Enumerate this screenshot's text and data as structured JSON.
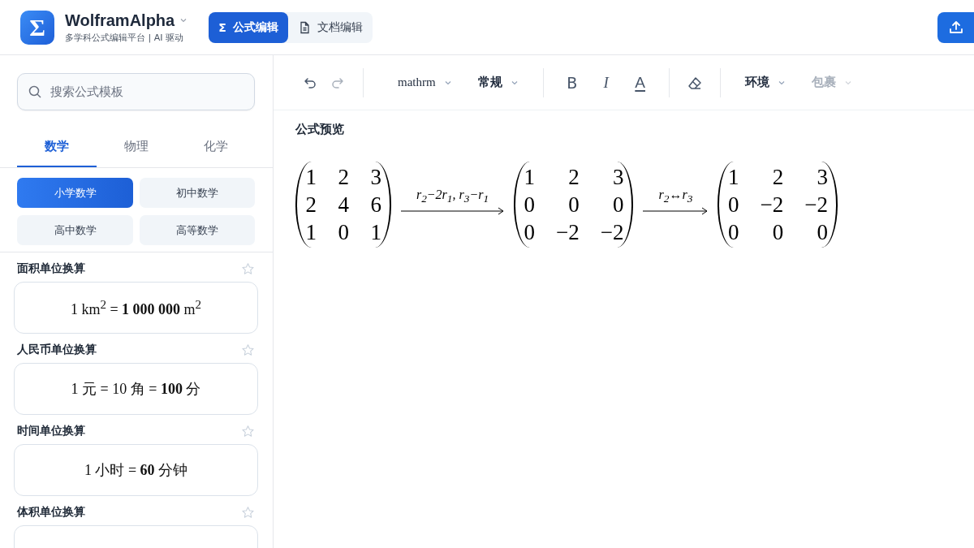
{
  "header": {
    "logo": "Σ",
    "title": "WolframAlpha",
    "subtitle": "多学科公式编辑平台 | AI 驱动",
    "modes": [
      {
        "label": "公式编辑",
        "glyph": "Σ",
        "selected": true
      },
      {
        "label": "文档编辑",
        "selected": false
      }
    ]
  },
  "sidebar": {
    "search": {
      "placeholder": "搜索公式模板"
    },
    "subjects": [
      {
        "label": "数学",
        "selected": true
      },
      {
        "label": "物理",
        "selected": false
      },
      {
        "label": "化学",
        "selected": false
      }
    ],
    "levels": [
      {
        "label": "小学数学",
        "selected": true
      },
      {
        "label": "初中数学",
        "selected": false
      },
      {
        "label": "高中数学",
        "selected": false
      },
      {
        "label": "高等数学",
        "selected": false
      }
    ],
    "templates": [
      {
        "title": "面积单位换算",
        "formula": "1 km$^{2}$ = **1 000 000** m$^{2}$"
      },
      {
        "title": "人民币单位换算",
        "formula": "1 元 = 10 角 = **100** 分"
      },
      {
        "title": "时间单位换算",
        "formula": "1 小时 = **60** 分钟"
      },
      {
        "title": "体积单位换算"
      }
    ]
  },
  "toolbar": [
    {
      "kind": "undo",
      "disabled": false
    },
    {
      "kind": "redo",
      "disabled": true
    },
    {
      "kind": "separator"
    },
    {
      "kind": "dropdown",
      "label": "mathrm",
      "serif": true,
      "disabled": false
    },
    {
      "kind": "dropdown",
      "label": "常规",
      "disabled": false
    },
    {
      "kind": "separator"
    },
    {
      "kind": "bold",
      "label": "B",
      "disabled": false
    },
    {
      "kind": "italic",
      "label": "I",
      "disabled": false
    },
    {
      "kind": "color",
      "label": "A",
      "disabled": false
    },
    {
      "kind": "separator"
    },
    {
      "kind": "eraser",
      "disabled": false
    },
    {
      "kind": "separator"
    },
    {
      "kind": "dropdown",
      "label": "环境",
      "disabled": false
    },
    {
      "kind": "dropdown",
      "label": "包裹",
      "disabled": true
    }
  ],
  "preview": {
    "title": "公式预览",
    "parts": [
      {
        "kind": "matrix",
        "rows": [
          [
            "1",
            "2",
            "3"
          ],
          [
            "2",
            "4",
            "6"
          ],
          [
            "1",
            "0",
            "1"
          ]
        ]
      },
      {
        "kind": "arrow",
        "label": "r$_{2}$−2r$_{1}$, r$_{3}$−r$_{1}$"
      },
      {
        "kind": "matrix",
        "rows": [
          [
            "1",
            "2",
            "3"
          ],
          [
            "0",
            "0",
            "0"
          ],
          [
            "0",
            "−2",
            "−2"
          ]
        ]
      },
      {
        "kind": "arrow",
        "label": "r$_{2}$↔r$_{3}$"
      },
      {
        "kind": "matrix",
        "rows": [
          [
            "1",
            "2",
            "3"
          ],
          [
            "0",
            "−2",
            "−2"
          ],
          [
            "0",
            "0",
            "0"
          ]
        ]
      }
    ]
  }
}
